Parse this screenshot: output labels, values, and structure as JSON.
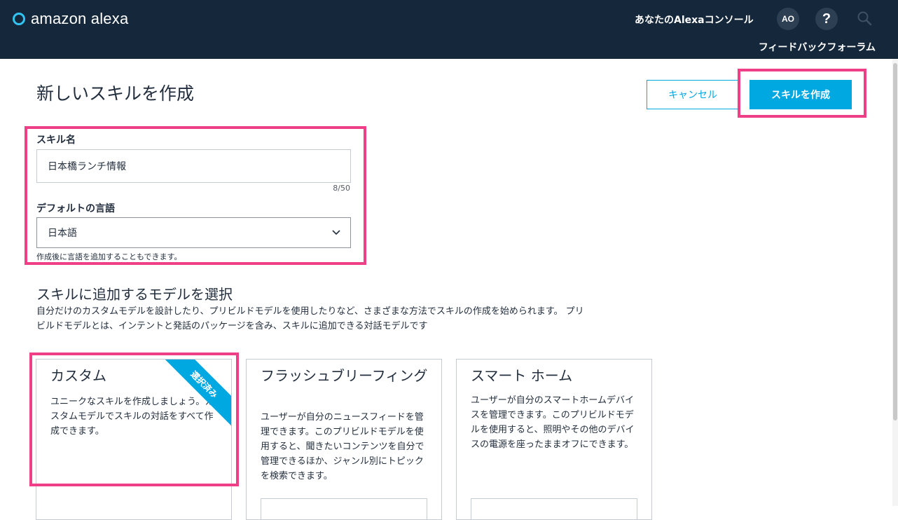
{
  "header": {
    "logo_text": "amazon alexa",
    "console_link": "あなたのAlexaコンソール",
    "avatar_initials": "AO",
    "help_label": "?",
    "feedback_link": "フィードバックフォーラム"
  },
  "page": {
    "title": "新しいスキルを作成",
    "cancel_label": "キャンセル",
    "create_label": "スキルを作成"
  },
  "form": {
    "skill_name_label": "スキル名",
    "skill_name_value": "日本橋ランチ情報",
    "skill_name_counter": "8/50",
    "language_label": "デフォルトの言語",
    "language_value": "日本語",
    "language_hint": "作成後に言語を追加することもできます。"
  },
  "models": {
    "section_title": "スキルに追加するモデルを選択",
    "section_desc": "自分だけのカスタムモデルを設計したり、プリビルドモデルを使用したりなど、さまざまな方法でスキルの作成を始められます。 プリビルドモデルとは、インテントと発話のパッケージを含み、スキルに追加できる対話モデルです",
    "cards": [
      {
        "title": "カスタム",
        "desc": "ユニークなスキルを作成しましょう。カスタムモデルでスキルの対話をすべて作成できます。",
        "badge": "選択済み",
        "selected": true
      },
      {
        "title": "フラッシュブリーフィング",
        "desc": "ユーザーが自分のニュースフィードを管理できます。このプリビルドモデルを使用すると、聞きたいコンテンツを自分で管理できるほか、ジャンル別にトピックを検索できます。"
      },
      {
        "title": "スマート ホーム",
        "desc": "ユーザーが自分のスマートホームデバイスを管理できます。このプリビルドモデルを使用すると、照明やその他のデバイスの電源を座ったままオフにできます。"
      }
    ]
  },
  "colors": {
    "header_bg": "#15283b",
    "accent": "#00a8e1",
    "highlight": "#ef3f87"
  }
}
